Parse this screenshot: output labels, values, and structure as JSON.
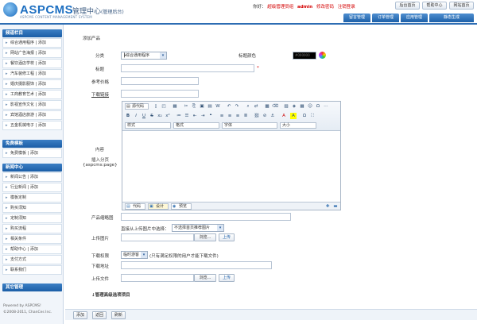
{
  "header": {
    "logo_text": "ASPCMS",
    "logo_sub": "管理中心",
    "logo_sub2": "(管理后台)",
    "logo_tag": "ASPCMS CONTENT MANAGEMENT SYSTEM",
    "greeting": "你好：",
    "role": "超级管理员组",
    "user": "admin",
    "change_pwd": "修改密码",
    "logout": "注销登录",
    "top_buttons": [
      "后台首页",
      "帮助中心",
      "网站首页"
    ],
    "tabs": [
      "留言管理",
      "订单管理",
      "应用管理",
      "静态生成"
    ]
  },
  "sidebar": {
    "sections": [
      {
        "title": "频道栏目",
        "items": [
          "综合通用程序 | 添加",
          "网站广告海报 | 添加",
          "餐饮酒店学校 | 添加",
          "汽车装修工程 | 添加",
          "婚庆摄影服饰 | 添加",
          "工商教育艺术 | 添加",
          "影视宣传文化 | 添加",
          "宾馆酒店旅游 | 添加",
          "五金机械电子 | 添加"
        ]
      },
      {
        "title": "免费模板",
        "items": [
          "免费模板 | 添加"
        ]
      },
      {
        "title": "新闻中心",
        "items": [
          "新闻公告 | 添加",
          "行业新闻 | 添加",
          "模板定制",
          "购买须知",
          "定制须知",
          "购买流程",
          "相关条件",
          "帮助中心 | 添加",
          "支付方式",
          "联系我们"
        ]
      },
      {
        "title": "其它管理",
        "items": []
      }
    ],
    "footer_line1": "Powered by ASPCMS!",
    "footer_line2": "©2008-2011, ChanCes Inc."
  },
  "main": {
    "breadcrumb": "添加产品",
    "category_label": "分类",
    "category_value": "┣综合通用程序",
    "title_color_label": "标题颜色",
    "title_color_value": "#000000",
    "title_label": "标题",
    "required_mark": "*",
    "price_label": "参考价格",
    "download_link_label": "下载链接",
    "content_label": "内容",
    "pagination_hint_1": "插入分页",
    "pagination_hint_2": "{aspcms:page}",
    "editor": {
      "source_label": "源代码",
      "format_label": "样式",
      "paragraph_label": "格式",
      "font_label": "字体",
      "size_label": "大小",
      "mode_code": "代码",
      "mode_design": "设计",
      "mode_preview": "预览"
    },
    "thumb_label": "产品缩略图",
    "pick_from_content": "直接从上传图片中选择：",
    "pick_select_value": "不选择首页推荐图片",
    "upload_image_label": "上传图片",
    "browse_label": "浏览...",
    "upload_button": "上传",
    "permission_label": "下载权限",
    "permission_value": "临时游客",
    "permission_note": "(只有满足权限的用户才能下载文件)",
    "download_addr_label": "下载地址",
    "upload_file_label": "上传文件",
    "advanced_label": "↓管理高级选项项目"
  },
  "bottom": {
    "buttons": [
      "添加",
      "返回",
      "刷新"
    ]
  },
  "colors": {
    "accent": "#1d60a8",
    "sidebar_bg": "#f1f5fa",
    "danger": "#d40000"
  }
}
